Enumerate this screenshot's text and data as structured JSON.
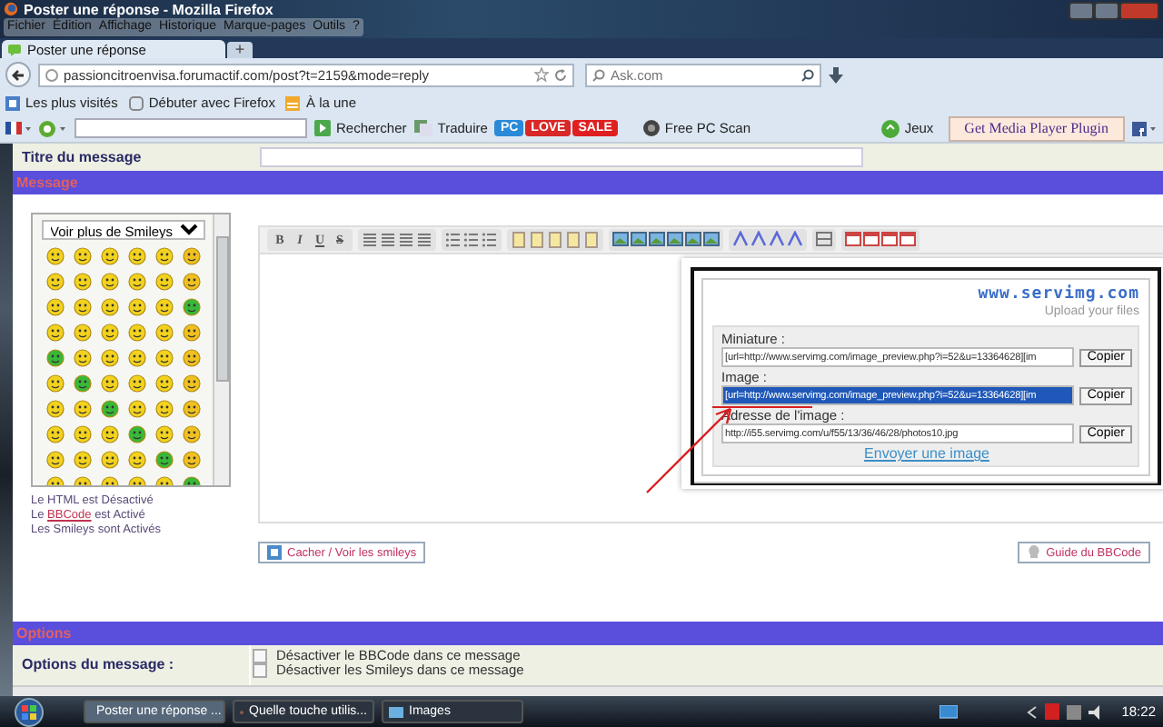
{
  "window": {
    "title": "Poster une réponse - Mozilla Firefox"
  },
  "menu": [
    "Fichier",
    "Édition",
    "Affichage",
    "Historique",
    "Marque-pages",
    "Outils",
    "?"
  ],
  "tabs": [
    {
      "label": "Poster une réponse",
      "selected": true
    }
  ],
  "new_tab": "+",
  "address": {
    "value": "passioncitroenvisa.forumactif.com/post?t=2159&mode=reply"
  },
  "search": {
    "placeholder": "Ask.com"
  },
  "bookmarks": [
    "Les plus visités",
    "Débuter avec Firefox",
    "À la une"
  ],
  "ask_toolbar": {
    "search_button": "Rechercher",
    "translate": "Traduire",
    "badges": [
      {
        "label": "PC",
        "color": "#2a8ad8"
      },
      {
        "label": "LOVE",
        "color": "#d82828"
      },
      {
        "label": "SALE",
        "color": "#e02020"
      }
    ],
    "scan": "Free PC Scan",
    "games": "Jeux",
    "plugin_button": "Get Media Player Plugin"
  },
  "form": {
    "title_label": "Titre du message",
    "message_header": "Message",
    "smileys_dropdown": "Voir plus de Smileys",
    "format_buttons": [
      "B",
      "I",
      "U",
      "S"
    ],
    "status_lines": [
      {
        "text": "Le HTML est Désactivé"
      },
      {
        "text": "Le",
        "link": "BBCode",
        "rest": "est Activé"
      },
      {
        "text": "Les Smileys sont Activés"
      }
    ],
    "toggle_smileys": "Cacher / Voir les smileys",
    "bbcode_guide": "Guide du BBCode",
    "options_header": "Options",
    "options_label": "Options du message :",
    "options": [
      {
        "label": "Désactiver le BBCode dans ce message",
        "checked": false
      },
      {
        "label": "Désactiver les Smileys dans ce message",
        "checked": false
      }
    ]
  },
  "upload_popup": {
    "logo": "www.servimg.com",
    "tagline": "Upload your files",
    "fields": [
      {
        "label": "Miniature :",
        "value": "[url=http://www.servimg.com/image_preview.php?i=52&u=13364628][im",
        "button": "Copier",
        "selected": false
      },
      {
        "label": "Image :",
        "value": "[url=http://www.servimg.com/image_preview.php?i=52&u=13364628][im",
        "button": "Copier",
        "selected": true
      },
      {
        "label": "Adresse de l'image :",
        "value": "http://i55.servimg.com/u/f55/13/36/46/28/photos10.jpg",
        "button": "Copier",
        "selected": false
      }
    ],
    "link": "Envoyer une image"
  },
  "taskbar": {
    "tasks": [
      {
        "label": "Poster une réponse ...",
        "selected": true
      },
      {
        "label": "Quelle touche utilis...",
        "selected": false
      },
      {
        "label": "Images",
        "selected": false
      }
    ],
    "clock": "18:22"
  }
}
